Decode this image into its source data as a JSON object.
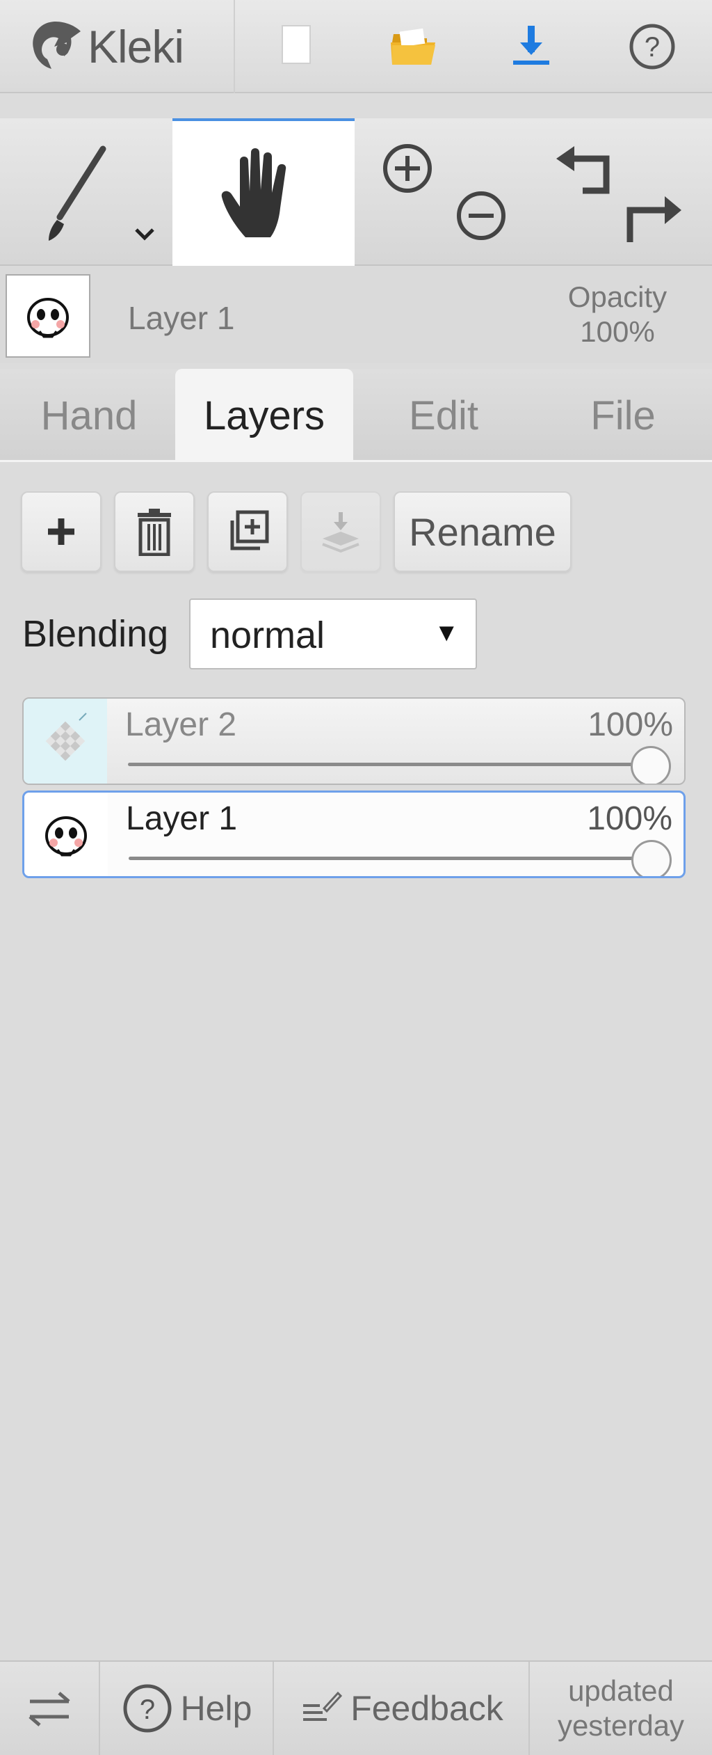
{
  "app": {
    "name": "Kleki"
  },
  "topbar": {
    "logo_text": "Kleki",
    "buttons": [
      {
        "name": "new-image",
        "icon": "new-image-icon"
      },
      {
        "name": "open-image",
        "icon": "folder-icon"
      },
      {
        "name": "save-image",
        "icon": "download-icon"
      },
      {
        "name": "help",
        "icon": "help-circle-icon"
      }
    ]
  },
  "tools": {
    "brush_icon": "brush-icon",
    "hand_icon": "hand-icon",
    "zoom_in_icon": "zoom-in-icon",
    "zoom_out_icon": "zoom-out-icon",
    "undo_icon": "undo-icon",
    "redo_icon": "redo-icon",
    "active_tool": "hand",
    "accent_color": "#4a90e2"
  },
  "layer_info": {
    "name": "Layer 1",
    "opacity_label": "Opacity",
    "opacity_value": "100%"
  },
  "tabs": [
    {
      "label": "Hand",
      "active": false
    },
    {
      "label": "Layers",
      "active": true
    },
    {
      "label": "Edit",
      "active": false
    },
    {
      "label": "File",
      "active": false
    }
  ],
  "layer_panel": {
    "buttons": {
      "add_icon": "plus-icon",
      "delete_icon": "trash-icon",
      "duplicate_icon": "duplicate-icon",
      "merge_icon": "merge-down-icon",
      "rename_label": "Rename"
    },
    "blending": {
      "label": "Blending",
      "value": "normal"
    },
    "layers": [
      {
        "name": "Layer 2",
        "opacity": "100%",
        "opacity_fraction": 1.0,
        "selected": false
      },
      {
        "name": "Layer 1",
        "opacity": "100%",
        "opacity_fraction": 1.0,
        "selected": true
      }
    ]
  },
  "bottombar": {
    "swap_icon": "swap-arrows-icon",
    "help_label": "Help",
    "feedback_label": "Feedback",
    "updated_line1": "updated",
    "updated_line2": "yesterday"
  }
}
